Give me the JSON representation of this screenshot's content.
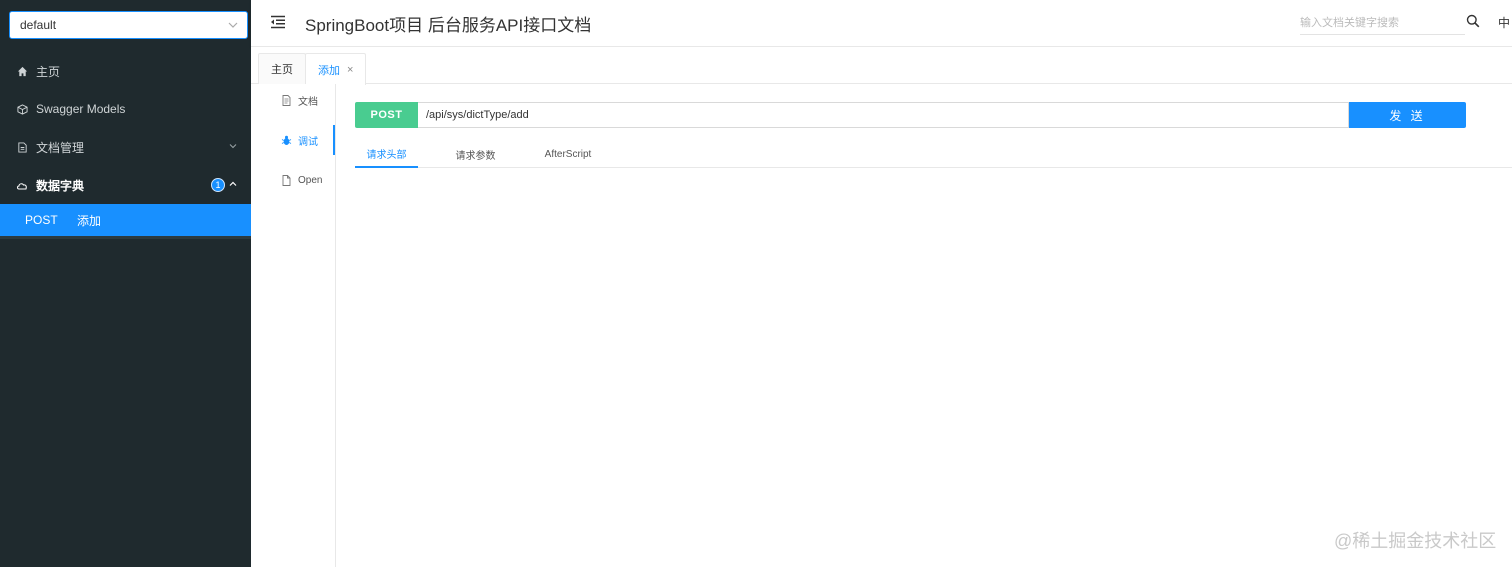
{
  "sidebar": {
    "group_select": {
      "value": "default"
    },
    "menu": [
      {
        "label": "主页",
        "icon": "home-icon"
      },
      {
        "label": "Swagger Models",
        "icon": "cube-icon"
      },
      {
        "label": "文档管理",
        "icon": "file-icon"
      },
      {
        "label": "数据字典",
        "icon": "cloud-icon",
        "badge": "1"
      }
    ],
    "submenu": [
      {
        "method": "POST",
        "label": "添加"
      }
    ]
  },
  "header": {
    "title": "SpringBoot项目 后台服务API接口文档",
    "search_placeholder": "输入文档关键字搜索",
    "lang": "中"
  },
  "page_tabs": [
    {
      "label": "主页"
    },
    {
      "label": "添加",
      "close": "×"
    }
  ],
  "doc_tabs": [
    {
      "label": "文档",
      "icon": "document-icon"
    },
    {
      "label": "调试",
      "icon": "bug-icon"
    },
    {
      "label": "Open",
      "icon": "open-file-icon"
    }
  ],
  "debug": {
    "method": "POST",
    "url": "/api/sys/dictType/add",
    "send_label": "发 送",
    "tabs": [
      {
        "label": "请求头部"
      },
      {
        "label": "请求参数"
      },
      {
        "label": "AfterScript"
      }
    ]
  },
  "watermark": "@稀土掘金技术社区",
  "colors": {
    "sidebar_bg": "#1f2a2e",
    "accent": "#1890ff",
    "post_green": "#49cc90"
  }
}
